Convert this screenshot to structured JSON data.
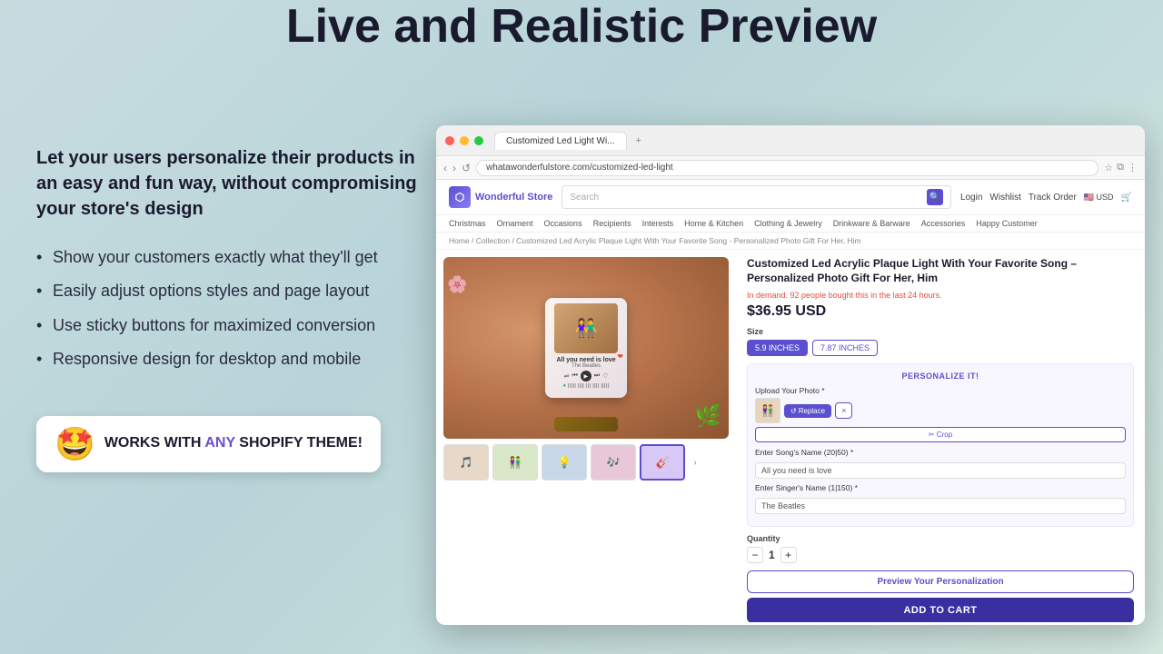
{
  "page": {
    "main_title": "Live and Realistic Preview",
    "subtitle": "Let your users personalize their products in an easy and fun way, without compromising your store's design",
    "bullet_points": [
      "Show your customers exactly what they'll get",
      "Easily adjust options styles and page layout",
      "Use sticky buttons for maximized conversion",
      "Responsive design for desktop and mobile"
    ],
    "badge": {
      "emoji": "🤩",
      "text_prefix": "WORKS WITH ",
      "text_highlight": "ANY",
      "text_suffix": " SHOPIFY THEME!"
    }
  },
  "browser": {
    "tab_label": "Customized Led Light Wi...",
    "url": "whatawonderfulstore.com/customized-led-light"
  },
  "store": {
    "name": "Wonderful Store",
    "nav_items": [
      "Christmas",
      "Ornament",
      "Occasions",
      "Recipients",
      "Interests",
      "Home & Kitchen",
      "Clothing & Jewelry",
      "Drinkware & Barware",
      "Accessories",
      "Happy Customer"
    ],
    "header_actions": [
      "Login",
      "Wishlist",
      "Track Order",
      "USD",
      "🛒"
    ],
    "search_placeholder": "Search"
  },
  "breadcrumb": "Home / Collection / Customized Led Acrylic Plaque Light With Your Favorite Song - Personalized Photo Gift For Her, Him",
  "product": {
    "title": "Customized Led Acrylic Plaque Light With Your Favorite Song – Personalized Photo Gift For Her, Him",
    "demand_text": "In demand. 92 people bought this in the last 24 hours.",
    "price": "$36.95 USD",
    "size_label": "Size",
    "sizes": [
      "5.9 INCHES",
      "7.87 INCHES"
    ],
    "active_size": "5.9 INCHES",
    "personalize_title": "PERSONALIZE IT!",
    "upload_label": "Upload Your Photo *",
    "replace_btn": "Replace",
    "remove_btn": "×",
    "crop_btn": "Crop",
    "song_name_label": "Enter Song's Name (20|50) *",
    "song_name_value": "All you need is love",
    "singer_name_label": "Enter Singer's Name (1|150) *",
    "singer_name_value": "The Beatles",
    "quantity_label": "Quantity",
    "quantity_value": "1",
    "preview_btn": "Preview Your Personalization",
    "add_cart_btn": "ADD TO CART",
    "song_card": {
      "title": "All you need is love",
      "artist": "The Beatles"
    }
  },
  "thumbnails": [
    "🎵",
    "👫",
    "💡",
    "🎶",
    "🎸"
  ],
  "colors": {
    "primary": "#5b4fcf",
    "dark_primary": "#3a2fa0",
    "accent_red": "#e74c3c",
    "text_dark": "#1a1a2e",
    "bg_gradient_start": "#c8dce0",
    "bg_gradient_end": "#d4e8e0"
  }
}
